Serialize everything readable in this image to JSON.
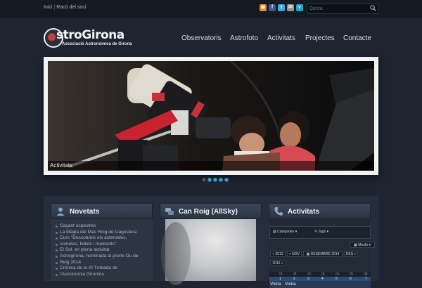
{
  "topbar": {
    "links": [
      "Inici",
      "Racó del soci"
    ],
    "search_placeholder": "Cerca",
    "social": [
      {
        "icon": "rss-icon",
        "color": "#f08a24",
        "glyph": "◉"
      },
      {
        "icon": "facebook-icon",
        "color": "#3b5998",
        "glyph": "f"
      },
      {
        "icon": "twitter-icon",
        "color": "#3ea8dd",
        "glyph": "t"
      },
      {
        "icon": "email-icon",
        "color": "#8f8f8f",
        "glyph": "✉"
      },
      {
        "icon": "vimeo-icon",
        "color": "#1aa5d1",
        "glyph": "v"
      }
    ]
  },
  "logo": {
    "name": "stroGirona",
    "subtitle": "Associació Astronòmica de Girona"
  },
  "nav": [
    "Observatoris",
    "Astrofoto",
    "Activitats",
    "Projectes",
    "Contacte"
  ],
  "slider": {
    "caption": "Activitats",
    "dots_total": 5,
    "active_dot": 1
  },
  "columns": {
    "news": {
      "title": "Novetats",
      "items": [
        "Caçant espectres",
        "La Màgia del Mas Roig de Llagostera",
        "Curs \"Descobreix els asteroides,",
        "cometes, bòlids i meteorits\".",
        "El Sol, en plena activitat",
        "Astrogirona, nominada al premi Ou de",
        "Reig 2014",
        "Crònica de la XI Trobada de",
        "l'Astronomia Gironina"
      ]
    },
    "allsky": {
      "title": "Can Roig (AllSky)"
    },
    "calendar": {
      "title": "Activitats",
      "categories": "Categories",
      "tags": "Tags",
      "view": "Month",
      "prev_year": "« 2013",
      "prev_month": "« NOV",
      "current": "DESEMBRE 2014",
      "next_month": "DES »",
      "next_year": "2015 »",
      "weekdays": [
        "dl.",
        "dt.",
        "dc.",
        "dj.",
        "dv.",
        "ds.",
        "dg."
      ],
      "days": [
        "1",
        "2",
        "3",
        "4",
        "5",
        "6",
        "7"
      ],
      "events": [
        "Visita",
        "Visita"
      ]
    }
  }
}
